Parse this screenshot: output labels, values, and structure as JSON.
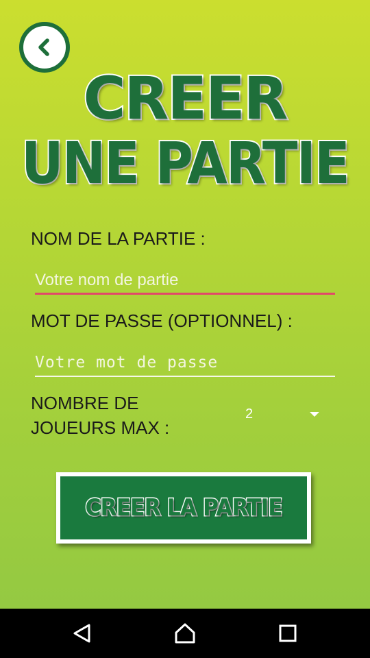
{
  "header": {
    "back_icon": "chevron-left-icon",
    "title_line1": "CREER",
    "title_line2": "UNE PARTIE"
  },
  "form": {
    "name_label": "NOM DE LA PARTIE :",
    "name_placeholder": "Votre nom de partie",
    "name_value": "",
    "password_label": "MOT DE PASSE (OPTIONNEL) :",
    "password_placeholder": "Votre mot de passe",
    "password_value": "",
    "players_label_line1": "NOMBRE DE",
    "players_label_line2": "JOUEURS MAX :",
    "players_selected": "2"
  },
  "actions": {
    "create_label": "CREER LA PARTIE"
  },
  "navbar": {
    "back_icon": "back-triangle-icon",
    "home_icon": "home-icon",
    "recent_icon": "recent-apps-icon"
  },
  "colors": {
    "background_top": "#cbde2f",
    "background_bottom": "#94c942",
    "brand_green": "#1e6f3a",
    "focus_underline": "#e2486a"
  }
}
